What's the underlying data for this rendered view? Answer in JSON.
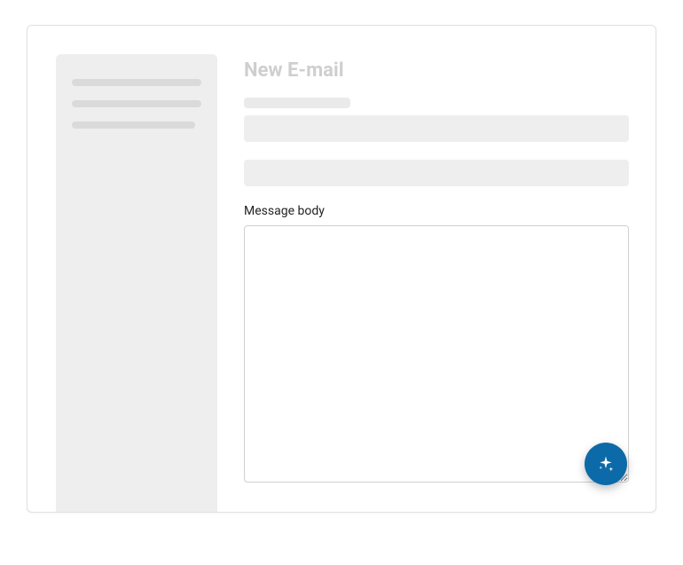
{
  "page": {
    "title": "New E-mail"
  },
  "form": {
    "body_label": "Message body",
    "body_value": ""
  },
  "fab": {
    "icon_name": "sparkle"
  }
}
